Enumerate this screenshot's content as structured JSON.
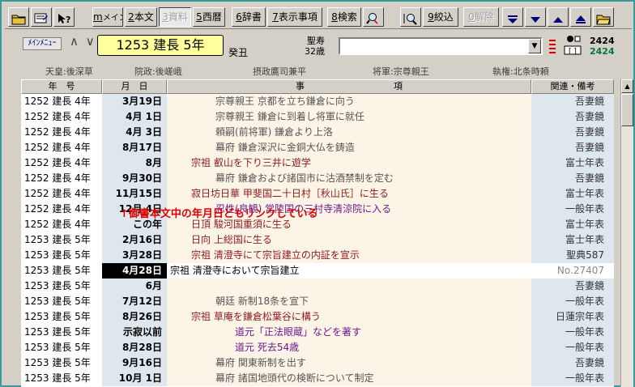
{
  "toolbar": {
    "b_menu": "メイン",
    "b_honbun": "本文",
    "b_shiryo": "資料",
    "b_seireki": "西暦",
    "b_jisho": "辞書",
    "b_hyoji": "表示事項",
    "b_kensaku": "検索",
    "b_shibori": "絞込",
    "b_kaijo": "解除",
    "k_menu": "m",
    "k_honbun": "2",
    "k_shiryo": "3",
    "k_seireki": "5",
    "k_jisho": "6",
    "k_hyoji": "7",
    "k_kensaku": "8",
    "k_shibori": "9",
    "k_kaijo": "0"
  },
  "header": {
    "menu_label": "ﾒｲﾝﾒﾆｭｰ",
    "nav_arrows": "∧ ∨",
    "era": "1253  建長  5年",
    "kanshi": "癸丑",
    "person_name": "聖寿",
    "person_age": "32歳",
    "combo_value": "",
    "counter_total": "2424",
    "counter_current": "2424"
  },
  "info": {
    "tenno": "天皇:後深草",
    "insei": "院政:後嵯峨",
    "sessho": "摂政鷹司兼平",
    "shogun": "将軍:宗尊親王",
    "shikken": "執権:北条時頼"
  },
  "table": {
    "headers": [
      "年　号",
      "月　日",
      "事　　　　　　　　　　項",
      "関連・備考"
    ],
    "rows": [
      {
        "year": "1252 建長 4年",
        "date": "3月19日",
        "event": "宗尊親王 京都を立ち鎌倉に向う",
        "src": "吾妻鏡"
      },
      {
        "year": "1252 建長 4年",
        "date": "4月 1日",
        "event": "宗尊親王 鎌倉に到着し将軍に就任",
        "src": "吾妻鏡"
      },
      {
        "year": "1252 建長 4年",
        "date": "4月 3日",
        "event": "頼嗣(前将軍) 鎌倉より上洛",
        "src": "吾妻鏡"
      },
      {
        "year": "1252 建長 4年",
        "date": "8月17日",
        "event": "幕府 鎌倉深沢に金銅大仏を鋳造",
        "src": "吾妻鏡"
      },
      {
        "year": "1252 建長 4年",
        "date": "8月",
        "event": "宗祖 叡山を下り三井に遊学",
        "src": "富士年表"
      },
      {
        "year": "1252 建長 4年",
        "date": "9月30日",
        "event": "幕府 鎌倉および諸国市に沽酒禁制を定む",
        "src": "吾妻鏡"
      },
      {
        "year": "1252 建長 4年",
        "date": "11月15日",
        "event": "寂日坊日華 甲斐国二十日村［秋山氏］に生る",
        "src": "富士年表"
      },
      {
        "year": "1252 建長 4年",
        "date": "12月 4日",
        "event": "忍性(良観) 常陸国の三村寺清涼院に入る",
        "src": "一般年表"
      },
      {
        "year": "1252 建長 4年",
        "date": "この年",
        "event": "日頂 駿河国重須に生る",
        "src": "富士年表"
      },
      {
        "year": "1253 建長 5年",
        "date": "2月16日",
        "event": "日向 上総国に生る",
        "src": "富士年表"
      },
      {
        "year": "1253 建長 5年",
        "date": "3月28日",
        "event": "宗祖 清澄寺にて宗旨建立の内証を宣示",
        "src": "聖典587"
      },
      {
        "year": "1253 建長 5年",
        "date": "4月28日",
        "event": "宗祖 清澄寺において宗旨建立",
        "src": "No.27407"
      },
      {
        "year": "1253 建長 5年",
        "date": "6月",
        "event": "",
        "src": "吾妻鏡"
      },
      {
        "year": "1253 建長 5年",
        "date": "7月12日",
        "event": "朝廷 新制18条を宣下",
        "src": "一般年表"
      },
      {
        "year": "1253 建長 5年",
        "date": "8月26日",
        "event": "宗祖 草庵を鎌倉松葉谷に構う",
        "src": "日蓮宗年表"
      },
      {
        "year": "1253 建長 5年",
        "date": "示寂以前",
        "event": "道元「正法眼蔵」などを著す",
        "src": "一般年表"
      },
      {
        "year": "1253 建長 5年",
        "date": "8月28日",
        "event": "道元 死去54歳",
        "src": "一般年表"
      },
      {
        "year": "1253 建長 5年",
        "date": "9月16日",
        "event": "幕府 関東新制を出す",
        "src": "吾妻鏡"
      },
      {
        "year": "1253 建長 5年",
        "date": "10月 1日",
        "event": "幕府 諸国地頭代の検断について制定",
        "src": "一般年表"
      }
    ]
  },
  "annotation": "↑御書本文中の年月日どもリンクしている",
  "colors": {
    "frame": "#3a9a9a",
    "date_col": "#dfe7ee",
    "event_col": "#fdf4e8",
    "era_box": "#ffff9c",
    "annotation": "#e00000",
    "sect_text": "#8b1a1a",
    "general_text": "#555555",
    "other_sect_text": "#6a1a8a"
  }
}
